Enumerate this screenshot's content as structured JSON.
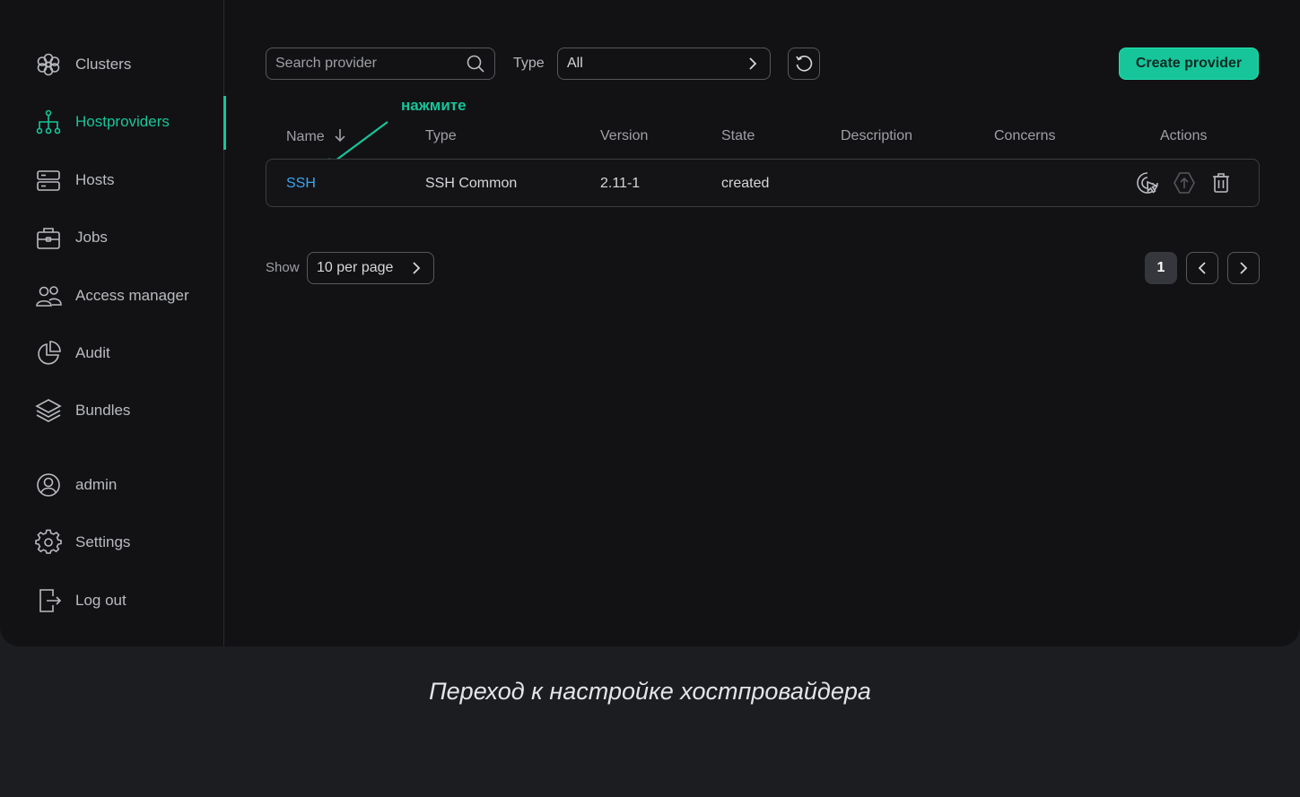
{
  "sidebar": {
    "items": [
      {
        "label": "Clusters",
        "icon": "clusters-icon"
      },
      {
        "label": "Hostproviders",
        "icon": "hostproviders-icon",
        "active": true
      },
      {
        "label": "Hosts",
        "icon": "hosts-icon"
      },
      {
        "label": "Jobs",
        "icon": "jobs-icon"
      },
      {
        "label": "Access manager",
        "icon": "users-icon"
      },
      {
        "label": "Audit",
        "icon": "pie-chart-icon"
      },
      {
        "label": "Bundles",
        "icon": "layers-icon"
      }
    ],
    "bottom_items": [
      {
        "label": "admin",
        "icon": "user-icon"
      },
      {
        "label": "Settings",
        "icon": "gear-icon"
      },
      {
        "label": "Log out",
        "icon": "logout-icon"
      }
    ]
  },
  "toolbar": {
    "search_placeholder": "Search provider",
    "type_label": "Type",
    "type_value": "All",
    "create_label": "Create provider"
  },
  "annotation": "нажмите",
  "table": {
    "columns": {
      "name": "Name",
      "type": "Type",
      "version": "Version",
      "state": "State",
      "description": "Description",
      "concerns": "Concerns",
      "actions": "Actions"
    },
    "rows": [
      {
        "name": "SSH",
        "type": "SSH Common",
        "version": "2.11-1",
        "state": "created",
        "description": "",
        "concerns": ""
      }
    ]
  },
  "pagination": {
    "show_label": "Show",
    "per_page": "10 per page",
    "current_page": "1"
  },
  "caption": "Переход к настройке хостпровайдера",
  "colors": {
    "accent": "#17c59a",
    "link": "#3aa6f2",
    "background": "#121214"
  }
}
